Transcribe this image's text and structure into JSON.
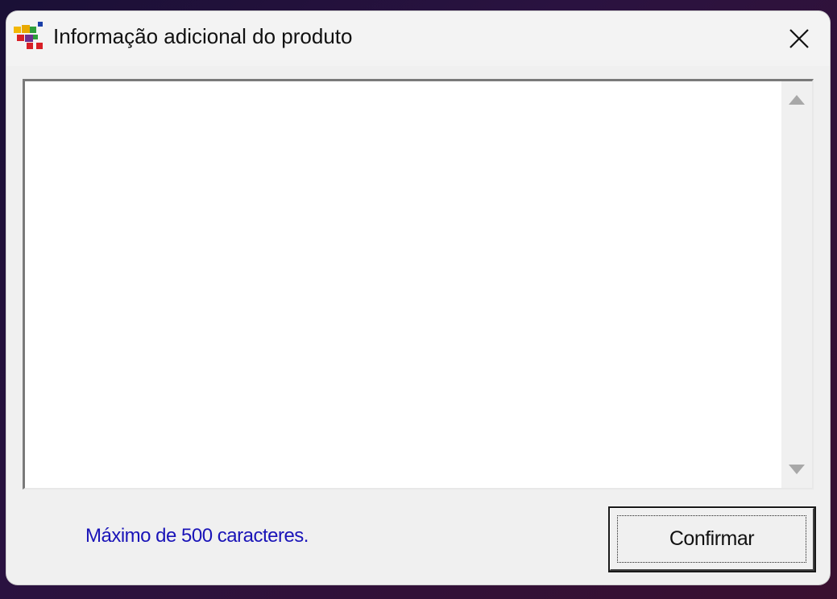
{
  "window": {
    "title": "Informação adicional do produto",
    "icon": "app-blocks-icon"
  },
  "textarea": {
    "value": "",
    "placeholder": ""
  },
  "footer": {
    "hint": "Máximo de 500 caracteres.",
    "confirm_label": "Confirmar"
  },
  "colors": {
    "hint_text": "#1a14b8",
    "window_bg": "#f0f0f0"
  }
}
